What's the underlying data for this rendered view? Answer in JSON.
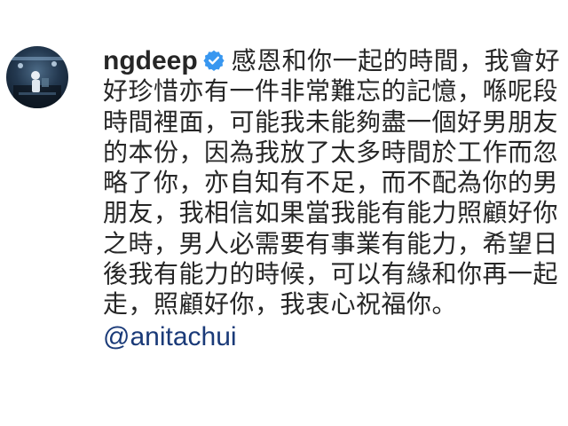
{
  "post": {
    "username": "ngdeep",
    "verified_badge_icon": "verified-badge-icon",
    "caption": "感恩和你一起的時間，我會好好珍惜亦有一件非常難忘的記憶，喺呢段時間裡面，可能我未能夠盡一個好男朋友的本份，因為我放了太多時間於工作而忽略了你，亦自知有不足，而不配為你的男朋友，我相信如果當我能有能力照顧好你之時，男人必需要有事業有能力，希望日後我有能力的時候，可以有緣和你再一起走，照顧好你，我衷心祝福你。",
    "mention": "@anitachui",
    "colors": {
      "text": "#262626",
      "mention": "#1a3a78",
      "verified": "#3897f0"
    }
  }
}
